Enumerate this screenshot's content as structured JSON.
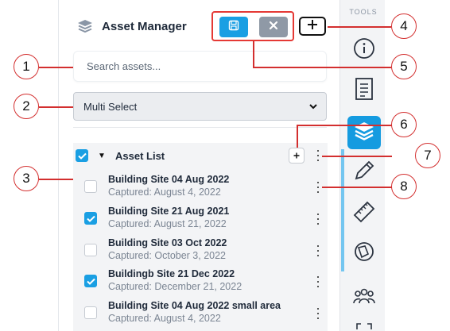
{
  "header": {
    "title": "Asset Manager",
    "layers_icon": "layers-icon"
  },
  "toolbar": {
    "save_icon": "save-icon",
    "cancel_icon": "close-icon",
    "add_icon": "plus-icon"
  },
  "search": {
    "placeholder": "Search assets..."
  },
  "select": {
    "value": "Multi Select"
  },
  "asset_list": {
    "title": "Asset List",
    "items": [
      {
        "name": "Building Site 04 Aug 2022",
        "captured": "Captured: August 4, 2022",
        "checked": false
      },
      {
        "name": "Building Site 21 Aug 2021",
        "captured": "Captured: August 21, 2022",
        "checked": true
      },
      {
        "name": "Building Site 03 Oct 2022",
        "captured": "Captured: October 3, 2022",
        "checked": false
      },
      {
        "name": "Buildingb Site 21 Dec 2022",
        "captured": "Captured: December 21, 2022",
        "checked": true
      },
      {
        "name": "Building Site 04 Aug 2022 small area",
        "captured": "Captured: August 4, 2022",
        "checked": false
      }
    ]
  },
  "sidebar": {
    "label": "TOOLS",
    "tools": [
      "info-icon",
      "document-icon",
      "layers-icon",
      "pencil-icon",
      "ruler-icon",
      "shape-icon",
      "users-icon",
      "expand-icon"
    ],
    "active_tool": "layers-icon"
  },
  "callouts": [
    "1",
    "2",
    "3",
    "4",
    "5",
    "6",
    "7",
    "8"
  ],
  "colors": {
    "accent": "#1a9fe3",
    "cancel": "#8f99a6",
    "callout": "#d32f2f",
    "active_strip": "#74c6f0"
  }
}
